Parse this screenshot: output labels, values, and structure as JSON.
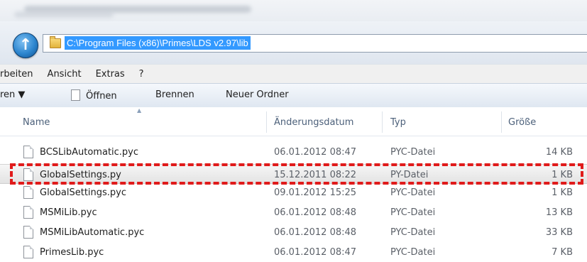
{
  "address": {
    "path": "C:\\Program Files (x86)\\Primes\\LDS v2.97\\lib"
  },
  "menu": {
    "items": [
      "rbeiten",
      "Ansicht",
      "Extras",
      "?"
    ]
  },
  "commands": {
    "organize": "ren ▼",
    "open": "Öffnen",
    "burn": "Brennen",
    "new_folder": "Neuer Ordner"
  },
  "columns": {
    "name": "Name",
    "date": "Änderungsdatum",
    "type": "Typ",
    "size": "Größe"
  },
  "files": [
    {
      "name": "BCSLibAutomatic.pyc",
      "date": "06.01.2012 08:47",
      "type": "PYC-Datei",
      "size": "14 KB"
    },
    {
      "name": "GlobalSettings.py",
      "date": "15.12.2011 08:22",
      "type": "PY-Datei",
      "size": "1 KB"
    },
    {
      "name": "GlobalSettings.pyc",
      "date": "09.01.2012 15:25",
      "type": "PYC-Datei",
      "size": "1 KB"
    },
    {
      "name": "MSMiLib.pyc",
      "date": "06.01.2012 08:48",
      "type": "PYC-Datei",
      "size": "13 KB"
    },
    {
      "name": "MSMiLibAutomatic.pyc",
      "date": "06.01.2012 08:48",
      "type": "PYC-Datei",
      "size": "33 KB"
    },
    {
      "name": "PrimesLib.pyc",
      "date": "06.01.2012 08:47",
      "type": "PYC-Datei",
      "size": "7 KB"
    }
  ],
  "selected_index": 1,
  "colors": {
    "highlight_box": "#e01b1b",
    "path_selection": "#3399ff"
  }
}
